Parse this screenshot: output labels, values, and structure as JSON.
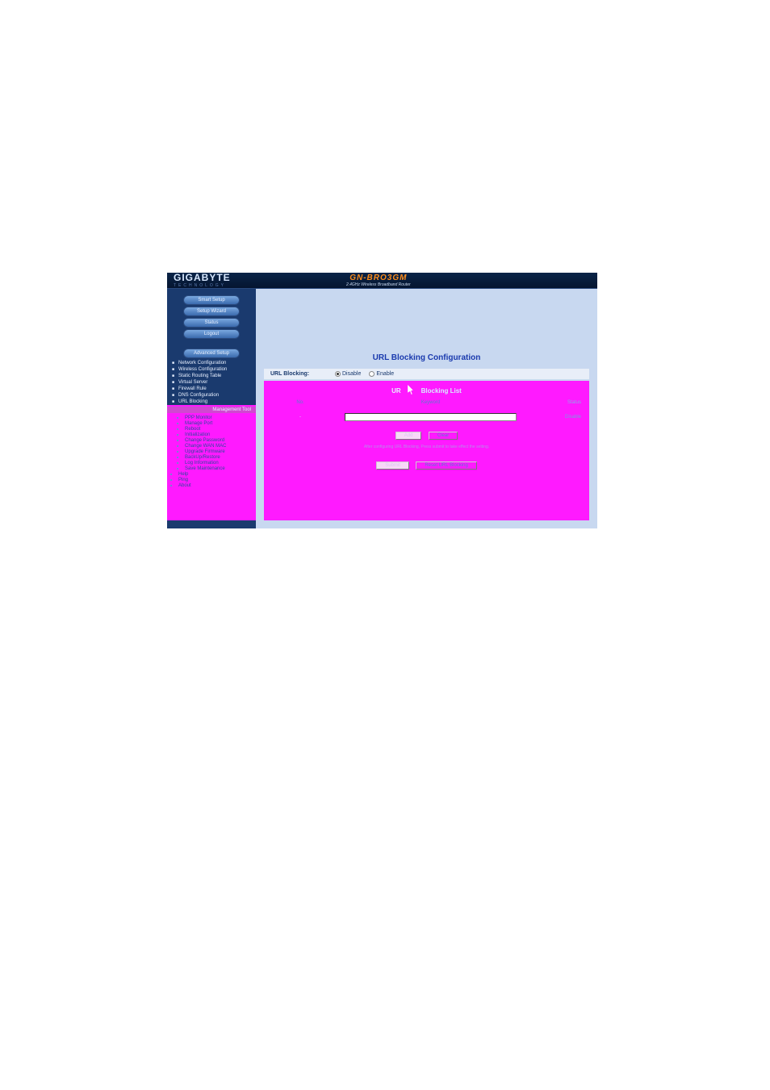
{
  "brand": {
    "name": "GIGABYTE",
    "sub": "TECHNOLOGY"
  },
  "product": {
    "name": "GN-BRO3GM",
    "desc": "2.4GHz Wireless Broadband Router"
  },
  "sidebar": {
    "smart_setup": "Smart Setup",
    "setup_wizard": "Setup Wizard",
    "status": "Status",
    "logout": "Logout",
    "advanced_setup": "Advanced Setup",
    "items": [
      "Network Configuration",
      "Wireless Configuration",
      "Static Routing Table",
      "Virtual Server",
      "Firewall Rule",
      "DNS Configuration",
      "URL Blocking"
    ],
    "mgmt_header": "Management Tool",
    "mgmt_items": [
      "PPP Monitor",
      "Manage Port",
      "Reboot",
      "Initialization",
      "Change Password",
      "Change WAN MAC",
      "Upgrade Firmware",
      "BackUp/Restore",
      "Log Information",
      "Save Maintenance"
    ],
    "mgmt_plain": [
      "Help",
      "Ping",
      "About"
    ]
  },
  "main": {
    "title": "URL Blocking Configuration",
    "form": {
      "label": "URL Blocking:",
      "disable": "Disable",
      "enable": "Enable",
      "selected": "disable"
    },
    "list": {
      "prefix": "UR",
      "header": "Blocking List",
      "col_no": "No.",
      "col_keyword": "Keyword",
      "col_status": "Status",
      "row_no": "-",
      "row_status": "Disable"
    },
    "buttons": {
      "add": "Add",
      "clear": "Clear",
      "submit": "Submit",
      "reset": "Reset URL Blocking"
    },
    "hint": "After configuring URL Blocking, Press submit to take effect the setting."
  }
}
